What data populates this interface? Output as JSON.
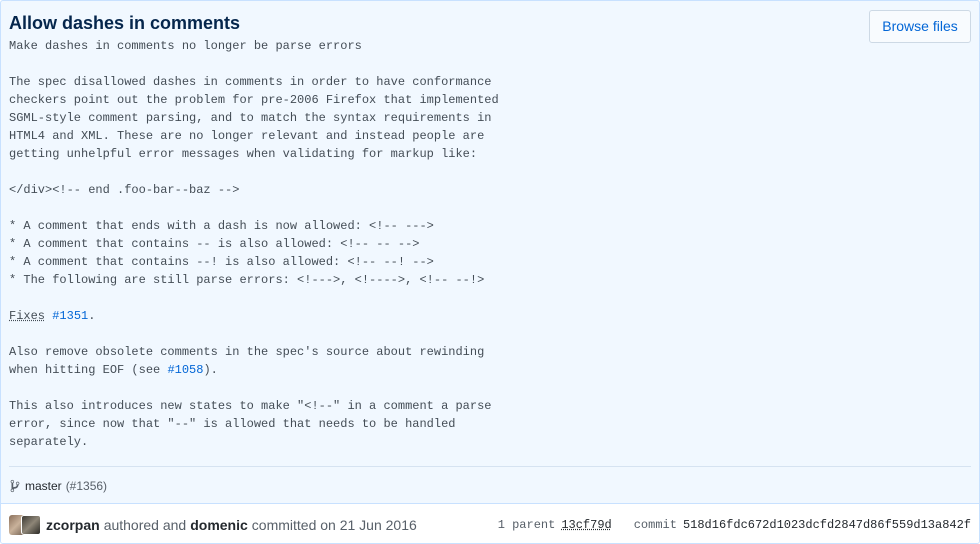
{
  "commit": {
    "title": "Allow dashes in comments",
    "browse_label": "Browse files",
    "description_lines": [
      "Make dashes in comments no longer be parse errors",
      "",
      "The spec disallowed dashes in comments in order to have conformance",
      "checkers point out the problem for pre-2006 Firefox that implemented",
      "SGML-style comment parsing, and to match the syntax requirements in",
      "HTML4 and XML. These are no longer relevant and instead people are",
      "getting unhelpful error messages when validating for markup like:",
      "",
      "</div><!-- end .foo-bar--baz -->",
      "",
      "* A comment that ends with a dash is now allowed: <!-- --->",
      "* A comment that contains -- is also allowed: <!-- -- -->",
      "* A comment that contains --! is also allowed: <!-- --! -->",
      "* The following are still parse errors: <!--->, <!---->, <!-- --!>",
      ""
    ],
    "fixes_word": "Fixes",
    "fixes_issue": "#1351",
    "fixes_suffix": ".",
    "para2_line1": "Also remove obsolete comments in the spec's source about rewinding",
    "para2_line2_prefix": "when hitting EOF (see ",
    "para2_issue": "#1058",
    "para2_line2_suffix": ").",
    "para3_lines": [
      "This also introduces new states to make \"<!--\" in a comment a parse",
      "error, since now that \"--\" is allowed that needs to be handled",
      "separately."
    ]
  },
  "branch": {
    "icon": "branch-icon",
    "name": "master",
    "pr": "(#1356)"
  },
  "meta": {
    "author": "zcorpan",
    "authored_text": "authored and",
    "committer": "domenic",
    "committed_text": "committed on 21 Jun 2016",
    "parent_label": "1 parent",
    "parent_sha": "13cf79d",
    "commit_label": "commit",
    "full_sha": "518d16fdc672d1023dcfd2847d86f559d13a842f"
  },
  "colors": {
    "accent": "#0366d6",
    "box_bg": "#f1f8ff",
    "border": "#c8e1ff",
    "title": "#05264c"
  }
}
